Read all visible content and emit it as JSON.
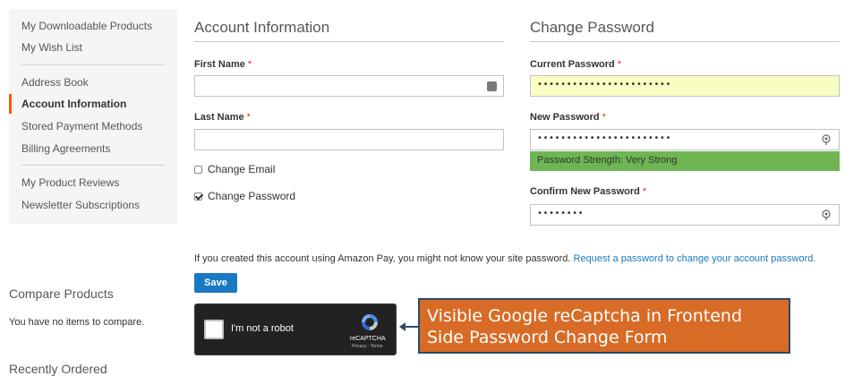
{
  "sidebar": {
    "items": [
      {
        "label": "My Downloadable Products"
      },
      {
        "label": "My Wish List"
      },
      {
        "label": "Address Book"
      },
      {
        "label": "Account Information"
      },
      {
        "label": "Stored Payment Methods"
      },
      {
        "label": "Billing Agreements"
      },
      {
        "label": "My Product Reviews"
      },
      {
        "label": "Newsletter Subscriptions"
      }
    ],
    "active_index": 3,
    "accent_color": "#ff5501"
  },
  "compare": {
    "title": "Compare Products",
    "empty_text": "You have no items to compare."
  },
  "recent": {
    "title": "Recently Ordered"
  },
  "account_info": {
    "title": "Account Information",
    "first_name_label": "First Name",
    "first_name_value": "",
    "last_name_label": "Last Name",
    "last_name_value": "",
    "required_mark": "*",
    "change_email_label": "Change Email",
    "change_email_checked": false,
    "change_password_label": "Change Password",
    "change_password_checked": true,
    "autofill_icon": "password-manager-icon"
  },
  "change_password": {
    "title": "Change Password",
    "current_label": "Current Password",
    "current_value": "•••••••••••••••••••••••",
    "new_label": "New Password",
    "new_value": "•••••••••••••••••••••••",
    "strength_text": "Password Strength: Very Strong",
    "strength_color": "#6fb553",
    "confirm_label": "Confirm New Password",
    "confirm_value": "••••••••",
    "reveal_icon": "password-reveal-icon"
  },
  "amazon_note": {
    "text": "If you created this account using Amazon Pay, you might not know your site password.",
    "link": "Request a password to change your account password."
  },
  "save_label": "Save",
  "recaptcha": {
    "label": "I'm not a robot",
    "brand": "reCAPTCHA",
    "links": "Privacy - Terms"
  },
  "callout": {
    "line1": "Visible Google reCaptcha in Frontend",
    "line2": "Side Password Change Form",
    "color": "#d86b26"
  }
}
